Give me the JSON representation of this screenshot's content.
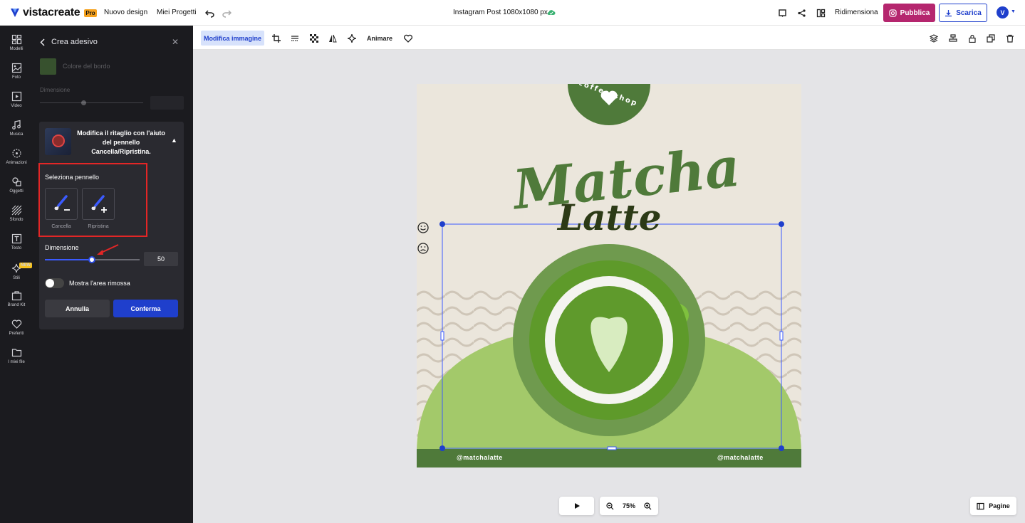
{
  "topbar": {
    "brand": "vistacreate",
    "pro_badge": "Pro",
    "new_design": "Nuovo design",
    "my_projects": "Miei Progetti",
    "doc_title": "Instagram Post 1080x1080 px",
    "resize": "Ridimensiona",
    "publish": "Pubblica",
    "download": "Scarica",
    "avatar_initial": "V"
  },
  "leftnav": {
    "items": [
      {
        "label": "Modelli",
        "icon": "grid-icon"
      },
      {
        "label": "Foto",
        "icon": "photo-icon"
      },
      {
        "label": "Video",
        "icon": "video-icon"
      },
      {
        "label": "Musica",
        "icon": "music-icon"
      },
      {
        "label": "Animazioni",
        "icon": "animation-icon"
      },
      {
        "label": "Oggetti",
        "icon": "shapes-icon"
      },
      {
        "label": "Sfondo",
        "icon": "background-icon"
      },
      {
        "label": "Testo",
        "icon": "text-icon"
      },
      {
        "label": "Stili",
        "icon": "sparkle-icon"
      },
      {
        "label": "Brand Kit",
        "icon": "briefcase-icon"
      },
      {
        "label": "Preferiti",
        "icon": "heart-icon"
      },
      {
        "label": "I miei file",
        "icon": "folder-icon"
      }
    ],
    "new_badge": "NEW"
  },
  "panel": {
    "title": "Crea adesivo",
    "border_color_label": "Colore del bordo",
    "border_color": "#37512e",
    "dimension_label_dim": "Dimensione",
    "card_title": "Modifica il ritaglio con l'aiuto del pennello Cancella/Ripristina.",
    "select_brush": "Seleziona pennello",
    "brush_erase": "Cancella",
    "brush_restore": "Ripristina",
    "size_label": "Dimensione",
    "size_value": "50",
    "size_fraction": 0.5,
    "show_removed": "Mostra l'area rimossa",
    "cancel": "Annulla",
    "confirm": "Conferma"
  },
  "toolbar2": {
    "edit_image": "Modifica immagine",
    "animate": "Animare"
  },
  "canvas": {
    "badge_text": "coffee shop",
    "title_line1": "Matcha",
    "title_line2": "Latte",
    "handle_left": "@matchalatte",
    "handle_right": "@matchalatte"
  },
  "bottom": {
    "zoom": "75%",
    "pages": "Pagine"
  },
  "colors": {
    "accent_blue": "#1f3fcc",
    "publish_magenta": "#b5266e",
    "matcha_dark": "#4f7a3a",
    "matcha_light": "#a3c96a"
  }
}
